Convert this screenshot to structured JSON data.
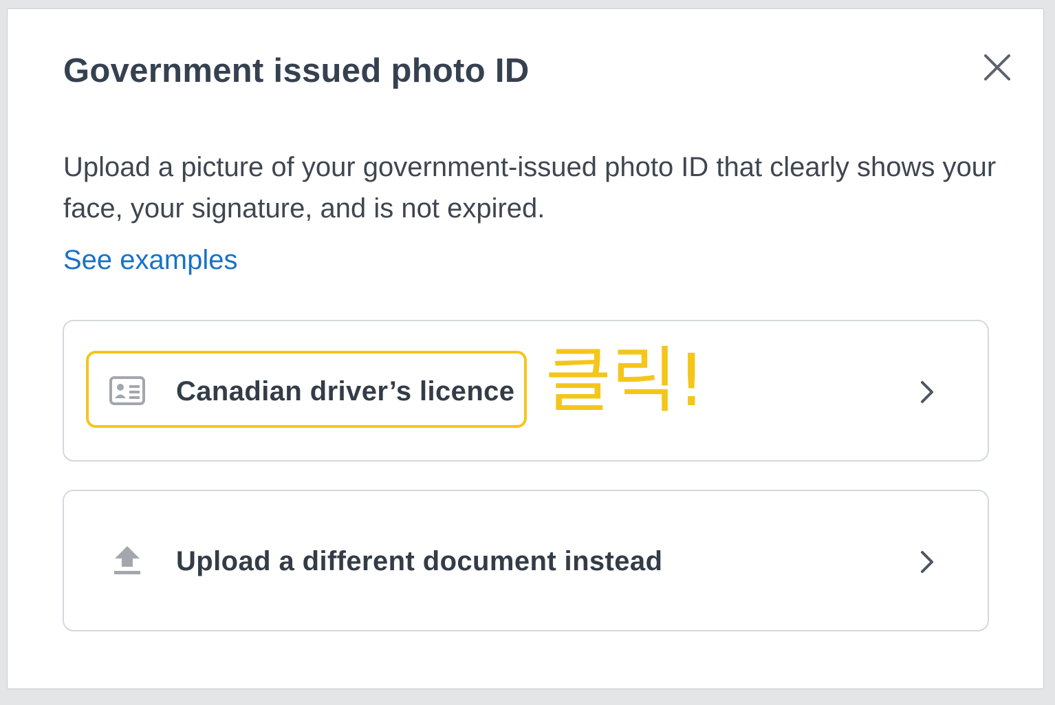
{
  "dialog": {
    "title": "Government issued photo ID",
    "description": "Upload a picture of your government-issued photo ID that clearly shows your face, your signature, and is not expired.",
    "examples_link": "See examples",
    "close_icon": "close-icon"
  },
  "options": [
    {
      "label": "Canadian driver’s licence",
      "icon": "id-card-icon",
      "highlighted": true,
      "annotation": "클릭!",
      "annotation_color": "#f4c61b"
    },
    {
      "label": "Upload a different document instead",
      "icon": "upload-icon",
      "highlighted": false
    }
  ],
  "colors": {
    "title_text": "#364150",
    "link": "#1872c9",
    "highlight": "#f4c61b",
    "card_border": "#d4d8de",
    "icon_gray": "#9a9ea4"
  }
}
